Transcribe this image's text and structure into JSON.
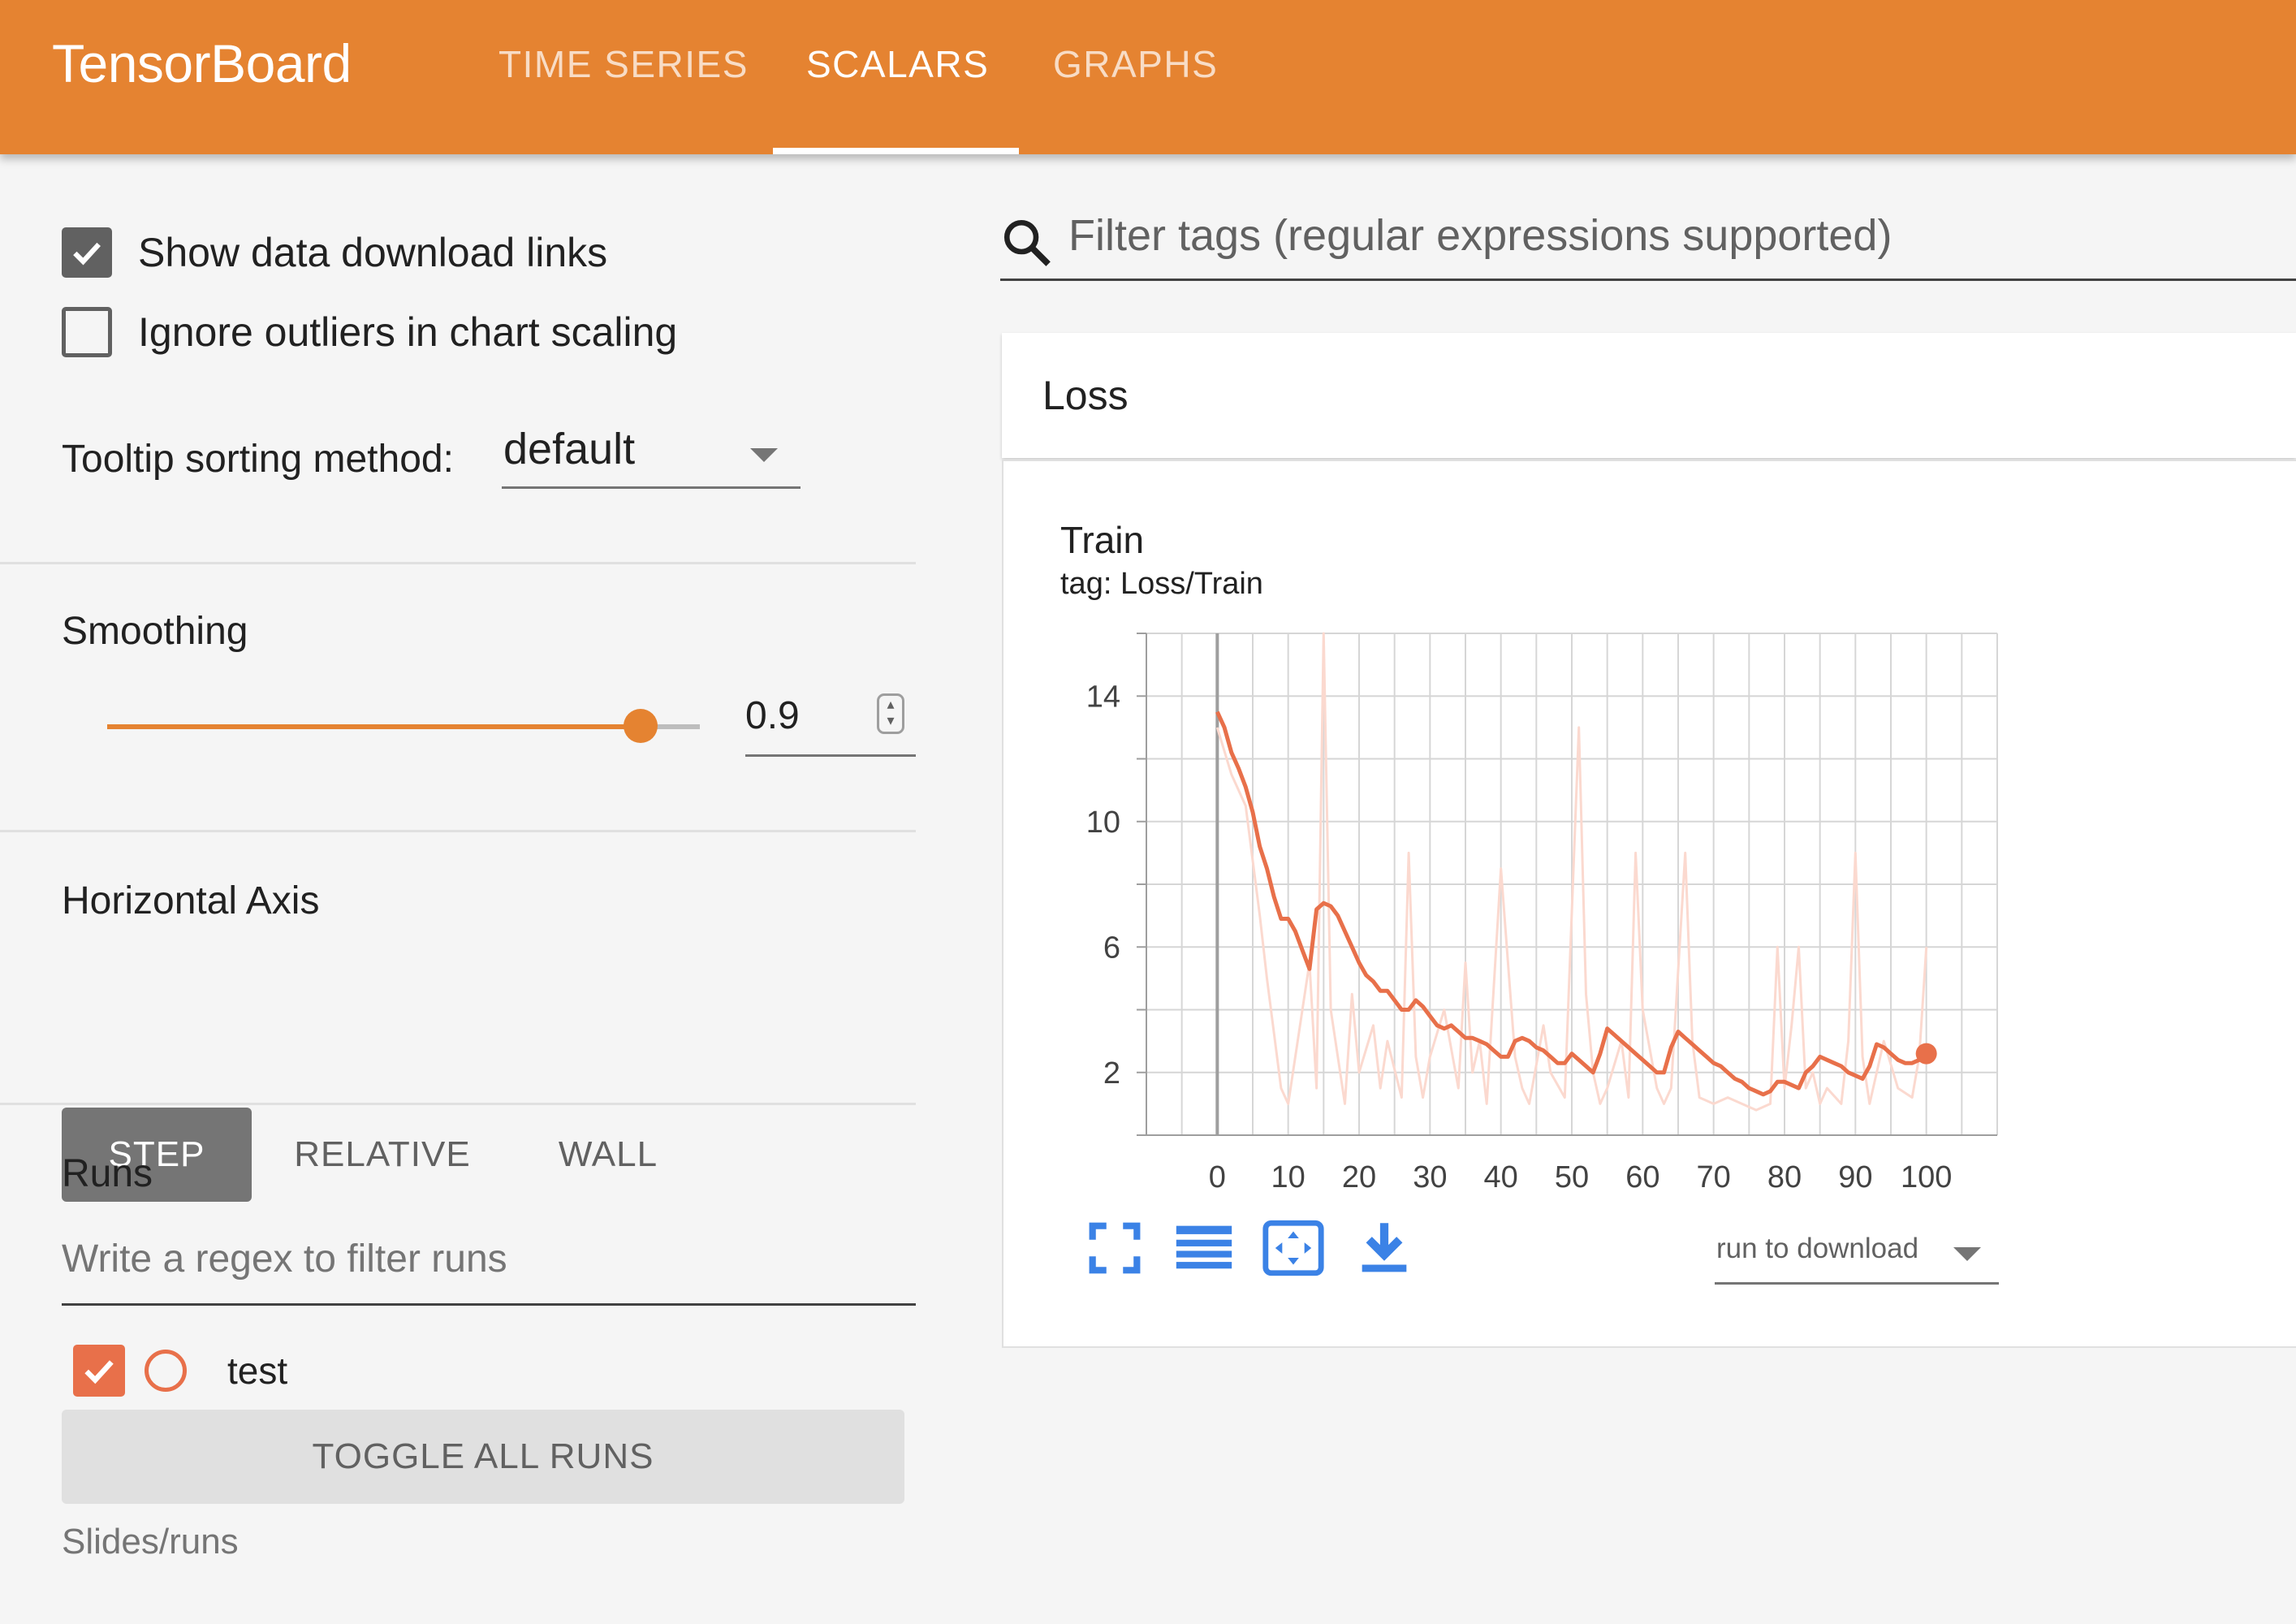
{
  "app": {
    "title": "TensorBoard"
  },
  "nav": {
    "tabs": [
      {
        "label": "TIME SERIES",
        "active": false
      },
      {
        "label": "SCALARS",
        "active": true
      },
      {
        "label": "GRAPHS",
        "active": false
      }
    ]
  },
  "sidebar": {
    "show_download_links": {
      "label": "Show data download links",
      "checked": true
    },
    "ignore_outliers": {
      "label": "Ignore outliers in chart scaling",
      "checked": false
    },
    "tooltip_sorting": {
      "label": "Tooltip sorting method:",
      "value": "default"
    },
    "smoothing": {
      "label": "Smoothing",
      "value": "0.9",
      "fraction": 0.9
    },
    "horizontal_axis": {
      "label": "Horizontal Axis",
      "options": [
        "STEP",
        "RELATIVE",
        "WALL"
      ],
      "selected": "STEP"
    },
    "runs": {
      "label": "Runs",
      "filter_placeholder": "Write a regex to filter runs",
      "items": [
        {
          "name": "test",
          "checked": true,
          "color": "#e8704a"
        }
      ],
      "toggle_all_label": "TOGGLE ALL RUNS",
      "footer": "Slides/runs"
    }
  },
  "main": {
    "filter_placeholder": "Filter tags (regular expressions supported)",
    "category": {
      "title": "Loss"
    },
    "card": {
      "title": "Train",
      "tag": "tag: Loss/Train",
      "download_select": "run to download",
      "actions": [
        "fullscreen-icon",
        "data-table-icon",
        "fit-domain-icon",
        "download-icon"
      ]
    }
  },
  "colors": {
    "header": "#e58331",
    "series_smoothed": "#e8704a",
    "series_raw": "#fbd9cf",
    "action_icons": "#3b82e6"
  },
  "chart_data": {
    "type": "line",
    "title": "Train",
    "xlabel": "",
    "ylabel": "",
    "x_ticks": [
      0,
      10,
      20,
      30,
      40,
      50,
      60,
      70,
      80,
      90,
      100
    ],
    "y_ticks": [
      2,
      6,
      10,
      14
    ],
    "xlim": [
      -10,
      110
    ],
    "ylim": [
      0,
      16
    ],
    "grid": true,
    "series": [
      {
        "style": "raw",
        "x": [
          0,
          2,
          4,
          6,
          7,
          9,
          10,
          13,
          14,
          15,
          16,
          18,
          19,
          20,
          22,
          23,
          24,
          26,
          27,
          28,
          29,
          30,
          32,
          34,
          35,
          36,
          37,
          38,
          40,
          42,
          43,
          44,
          46,
          47,
          49,
          51,
          52,
          53,
          54,
          55,
          57,
          58,
          59,
          60,
          62,
          63,
          64,
          66,
          67,
          68,
          70,
          72,
          74,
          76,
          78,
          79,
          80,
          81,
          82,
          83,
          84,
          85,
          86,
          88,
          89,
          90,
          91,
          92,
          94,
          96,
          98,
          99,
          100
        ],
        "values": [
          13.0,
          11.5,
          10.5,
          7.0,
          5.0,
          1.5,
          1.0,
          5.5,
          1.5,
          16.0,
          4.0,
          1.0,
          4.5,
          2.0,
          3.5,
          1.5,
          3.0,
          1.2,
          9.0,
          2.5,
          1.2,
          2.5,
          4.0,
          1.5,
          5.5,
          2.0,
          3.0,
          1.0,
          8.5,
          2.5,
          1.5,
          1.0,
          3.5,
          2.0,
          1.2,
          13.0,
          4.5,
          2.0,
          1.0,
          1.5,
          3.0,
          1.2,
          9.0,
          4.0,
          1.5,
          1.0,
          1.5,
          9.0,
          3.0,
          1.2,
          1.0,
          1.2,
          1.0,
          0.8,
          1.0,
          6.0,
          1.5,
          3.5,
          6.0,
          1.5,
          2.0,
          1.0,
          1.5,
          1.0,
          3.0,
          9.0,
          2.5,
          1.0,
          3.0,
          1.5,
          1.2,
          2.5,
          6.0
        ]
      },
      {
        "style": "smoothed",
        "x": [
          0,
          1,
          2,
          3,
          4,
          5,
          6,
          7,
          8,
          9,
          10,
          11,
          12,
          13,
          14,
          15,
          16,
          17,
          18,
          19,
          20,
          21,
          22,
          23,
          24,
          25,
          26,
          27,
          28,
          29,
          30,
          31,
          32,
          33,
          34,
          35,
          36,
          37,
          38,
          39,
          40,
          41,
          42,
          43,
          44,
          45,
          46,
          47,
          48,
          49,
          50,
          51,
          52,
          53,
          54,
          55,
          56,
          57,
          58,
          59,
          60,
          61,
          62,
          63,
          64,
          65,
          66,
          67,
          68,
          69,
          70,
          71,
          72,
          73,
          74,
          75,
          76,
          77,
          78,
          79,
          80,
          81,
          82,
          83,
          84,
          85,
          86,
          87,
          88,
          89,
          90,
          91,
          92,
          93,
          94,
          95,
          96,
          97,
          98,
          99,
          100
        ],
        "values": [
          13.5,
          13.0,
          12.2,
          11.7,
          11.1,
          10.3,
          9.2,
          8.5,
          7.6,
          6.9,
          6.9,
          6.5,
          5.9,
          5.3,
          7.2,
          7.4,
          7.3,
          7.0,
          6.5,
          6.0,
          5.5,
          5.1,
          4.9,
          4.6,
          4.6,
          4.3,
          4.0,
          4.0,
          4.3,
          4.1,
          3.8,
          3.5,
          3.4,
          3.5,
          3.3,
          3.1,
          3.1,
          3.0,
          2.9,
          2.7,
          2.5,
          2.5,
          3.0,
          3.1,
          3.0,
          2.8,
          2.7,
          2.5,
          2.3,
          2.3,
          2.6,
          2.4,
          2.2,
          2.0,
          2.6,
          3.4,
          3.2,
          3.0,
          2.8,
          2.6,
          2.4,
          2.2,
          2.0,
          2.0,
          2.8,
          3.3,
          3.1,
          2.9,
          2.7,
          2.5,
          2.3,
          2.2,
          2.0,
          1.8,
          1.7,
          1.5,
          1.4,
          1.3,
          1.4,
          1.7,
          1.7,
          1.6,
          1.5,
          2.0,
          2.2,
          2.5,
          2.4,
          2.3,
          2.2,
          2.0,
          1.9,
          1.8,
          2.2,
          2.9,
          2.8,
          2.6,
          2.4,
          2.3,
          2.3,
          2.4,
          2.6
        ]
      }
    ]
  }
}
